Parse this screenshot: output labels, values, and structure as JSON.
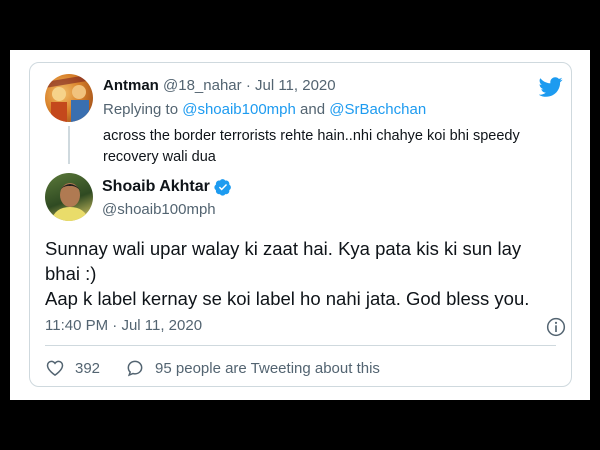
{
  "reply": {
    "name": "Antman",
    "handle": "@18_nahar",
    "separator": "·",
    "date": "Jul 11, 2020",
    "replying_prefix": "Replying to",
    "mention_1": "@shoaib100mph",
    "and_word": "and",
    "mention_2": "@SrBachchan",
    "text": "across the border terrorists rehte hain..nhi chahye koi bhi speedy recovery wali dua"
  },
  "tweet": {
    "name": "Shoaib Akhtar",
    "handle": "@shoaib100mph",
    "line_1": "Sunnay wali upar walay ki zaat hai. Kya pata kis ki sun lay bhai :)",
    "line_2": "Aap k label kernay se koi label ho nahi jata. God bless you.",
    "time": "11:40 PM",
    "separator": "·",
    "date": "Jul 11, 2020",
    "likes": "392",
    "tweeting_text": "95 people are Tweeting about this"
  },
  "icons": {
    "brand": "twitter-bird-icon",
    "verified": "verified-badge-icon",
    "info": "info-icon",
    "like": "heart-icon",
    "comment": "speech-bubble-icon"
  },
  "colors": {
    "accent": "#1d9bf0",
    "text": "#0f1419",
    "secondary": "#536471",
    "border": "#cfd9de",
    "background": "#000000"
  }
}
